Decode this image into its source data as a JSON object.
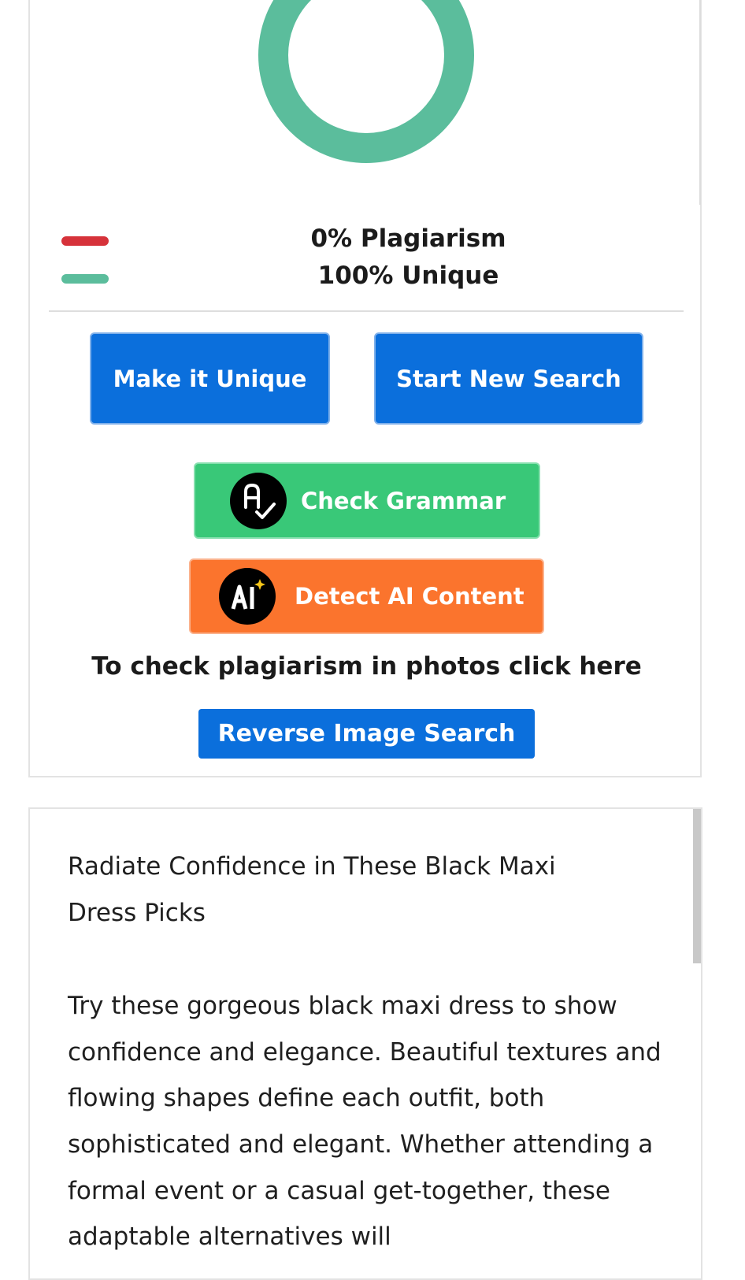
{
  "result": {
    "plagiarism_percent": 0,
    "unique_percent": 100,
    "plagiarism_label": "0% Plagiarism",
    "unique_label": "100% Unique",
    "colors": {
      "plagiarism": "#d6323a",
      "unique": "#5bbd9c"
    }
  },
  "actions": {
    "make_unique": "Make it Unique",
    "start_new_search": "Start New Search",
    "check_grammar": "Check Grammar",
    "detect_ai": "Detect AI Content",
    "photos_prompt": "To check plagiarism in photos click here",
    "reverse_image_search": "Reverse Image Search"
  },
  "icons": {
    "grammar": "spellcheck-icon",
    "ai": "ai-sparkle-icon"
  },
  "content": {
    "title": "Radiate Confidence in These Black Maxi Dress Picks",
    "paragraph": "Try these gorgeous black maxi dress to show confidence and elegance. Beautiful textures and flowing shapes define each outfit, both sophisticated and elegant. Whether attending a formal event or a casual get-together, these adaptable alternatives will"
  }
}
